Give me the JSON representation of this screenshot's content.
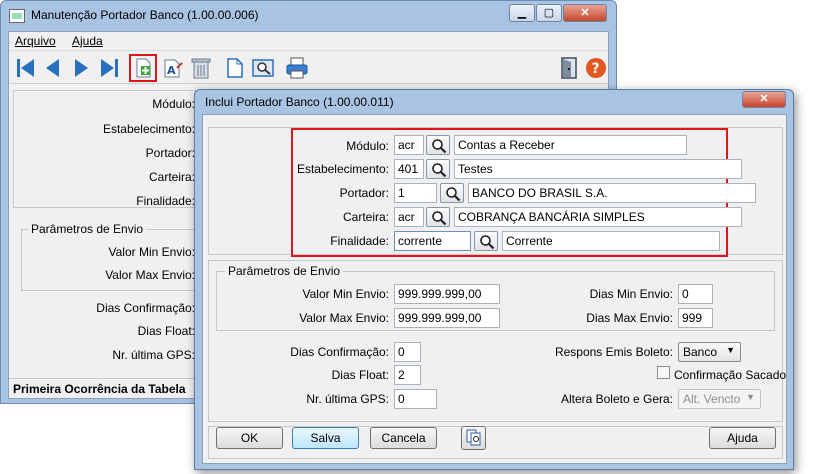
{
  "main_window": {
    "title": "Manutenção Portador Banco (1.00.00.006)",
    "menu": [
      "Arquivo",
      "Ajuda"
    ],
    "labels": {
      "modulo": "Módulo:",
      "estabelecimento": "Estabelecimento:",
      "portador": "Portador:",
      "carteira": "Carteira:",
      "finalidade": "Finalidade:",
      "parametros_envio": "Parâmetros de Envio",
      "valor_min_envio": "Valor Min Envio:",
      "valor_max_envio": "Valor Max Envio:",
      "dias_confirmacao": "Dias Confirmação:",
      "dias_float": "Dias Float:",
      "nr_ultima_gps": "Nr. última GPS:"
    },
    "status": "Primeira Ocorrência da Tabela",
    "toolbar_icons": [
      "first-icon",
      "prev-icon",
      "next-icon",
      "last-icon",
      "add-icon",
      "edit-icon",
      "delete-icon",
      "copy-icon",
      "zoom-icon",
      "print-icon",
      "exit-icon",
      "help-icon"
    ]
  },
  "dialog": {
    "title": "Inclui Portador Banco (1.00.00.011)",
    "fields": {
      "modulo": {
        "label": "Módulo:",
        "code": "acr",
        "desc": "Contas a Receber"
      },
      "estabelecimento": {
        "label": "Estabelecimento:",
        "code": "401",
        "desc": "Testes"
      },
      "portador": {
        "label": "Portador:",
        "code": "1",
        "desc": "BANCO DO BRASIL S.A."
      },
      "carteira": {
        "label": "Carteira:",
        "code": "acr",
        "desc": "COBRANÇA BANCÁRIA SIMPLES"
      },
      "finalidade": {
        "label": "Finalidade:",
        "code": "corrente",
        "desc": "Corrente"
      }
    },
    "parametros": {
      "caption": "Parâmetros de Envio",
      "valor_min_label": "Valor Min Envio:",
      "valor_min": "999.999.999,00",
      "valor_max_label": "Valor Max Envio:",
      "valor_max": "999.999.999,00",
      "dias_min_label": "Dias Min Envio:",
      "dias_min": "0",
      "dias_max_label": "Dias Max Envio:",
      "dias_max": "999",
      "dias_conf_label": "Dias Confirmação:",
      "dias_conf": "0",
      "dias_float_label": "Dias Float:",
      "dias_float": "2",
      "nr_gps_label": "Nr. última GPS:",
      "nr_gps": "0",
      "respons_label": "Respons Emis Boleto:",
      "respons_value": "Banco",
      "confirmacao_sacado": "Confirmação Sacado",
      "altera_label": "Altera Boleto e Gera:",
      "altera_value": "Alt. Vencto"
    },
    "buttons": {
      "ok": "OK",
      "salva": "Salva",
      "cancela": "Cancela",
      "ajuda": "Ajuda"
    }
  },
  "colors": {
    "highlight": "#e0141e",
    "frame": "#a9c4e2"
  }
}
